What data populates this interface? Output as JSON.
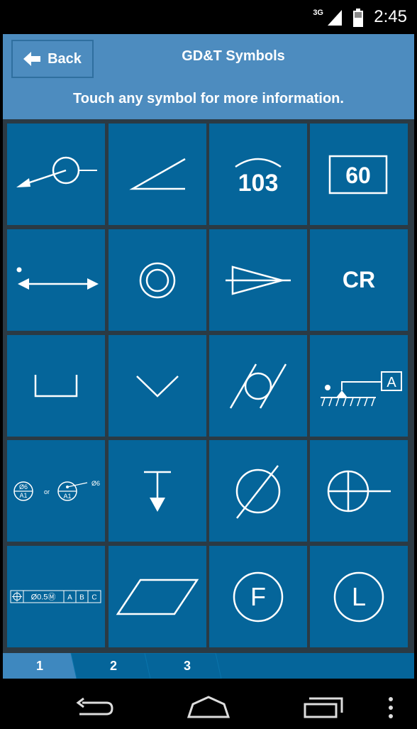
{
  "status_bar": {
    "network": "3G",
    "time": "2:45"
  },
  "header": {
    "back_label": "Back",
    "title": "GD&T Symbols",
    "subtitle": "Touch any symbol for more information."
  },
  "symbols": {
    "arc_length_text": "103",
    "basic_dimension_text": "60",
    "controlled_radius_text": "CR",
    "datum_target_letter": "A",
    "datum_target_or": "or",
    "datum_target_size1": "Ø6",
    "datum_target_size2": "Ø6",
    "datum_target_id1": "A1",
    "datum_target_id2": "A1",
    "fcf_tolerance": "Ø0.5Ⓜ",
    "fcf_datum_a": "A",
    "fcf_datum_b": "B",
    "fcf_datum_c": "C",
    "free_state_letter": "F",
    "lmc_letter": "L"
  },
  "pager": {
    "pages": [
      "1",
      "2",
      "3"
    ],
    "active": "1"
  },
  "colors": {
    "cell": "#05659a",
    "header": "#4d8cbf",
    "grid_lines": "#2b3a44"
  },
  "icons": [
    "back-arrow-icon",
    "back-nav-icon",
    "home-nav-icon",
    "recents-nav-icon",
    "overflow-menu-icon"
  ]
}
